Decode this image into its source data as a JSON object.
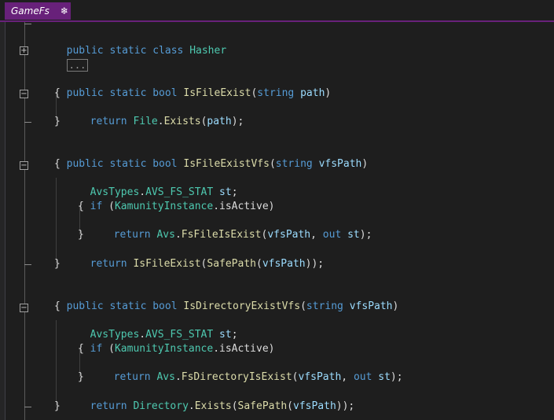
{
  "tab": {
    "label": "GameFs",
    "pin_icon": "❄"
  },
  "code": {
    "class_decl": {
      "kw": "public static class",
      "name": "Hasher"
    },
    "collapsed_region": "...",
    "m1": {
      "sig_kw": "public static bool",
      "name": "IsFileExist",
      "param_type": "string",
      "param": "path",
      "open": "{",
      "ret_kw": "return",
      "cls": "File",
      "call": "Exists",
      "arg": "path",
      "close": "}"
    },
    "m2": {
      "sig_kw": "public static bool",
      "name": "IsFileExistVfs",
      "param_type": "string",
      "param": "vfsPath",
      "open": "{",
      "decl_type": "AvsTypes",
      "decl_sub": "AVS_FS_STAT",
      "decl_var": "st",
      "if_kw": "if",
      "if_obj": "KamunityInstance",
      "if_prop": "isActive",
      "inner_open": "{",
      "ret_kw": "return",
      "inner_cls": "Avs",
      "inner_call": "FsFileIsExist",
      "inner_arg": "vfsPath",
      "out_kw": "out",
      "out_var": "st",
      "inner_close": "}",
      "ret2_call": "IsFileExist",
      "ret2_inner": "SafePath",
      "ret2_arg": "vfsPath",
      "close": "}"
    },
    "m3": {
      "sig_kw": "public static bool",
      "name": "IsDirectoryExistVfs",
      "param_type": "string",
      "param": "vfsPath",
      "open": "{",
      "decl_type": "AvsTypes",
      "decl_sub": "AVS_FS_STAT",
      "decl_var": "st",
      "if_kw": "if",
      "if_obj": "KamunityInstance",
      "if_prop": "isActive",
      "inner_open": "{",
      "ret_kw": "return",
      "inner_cls": "Avs",
      "inner_call": "FsDirectoryIsExist",
      "inner_arg": "vfsPath",
      "out_kw": "out",
      "out_var": "st",
      "inner_close": "}",
      "ret2_cls": "Directory",
      "ret2_call": "Exists",
      "ret2_inner": "SafePath",
      "ret2_arg": "vfsPath",
      "close": "}"
    }
  },
  "colors": {
    "accent_tab": "#68217a",
    "keyword": "#569cd6",
    "type": "#4ec9b0",
    "method": "#dcdcaa",
    "parameter": "#9cdcfe",
    "background": "#1e1e1e"
  }
}
